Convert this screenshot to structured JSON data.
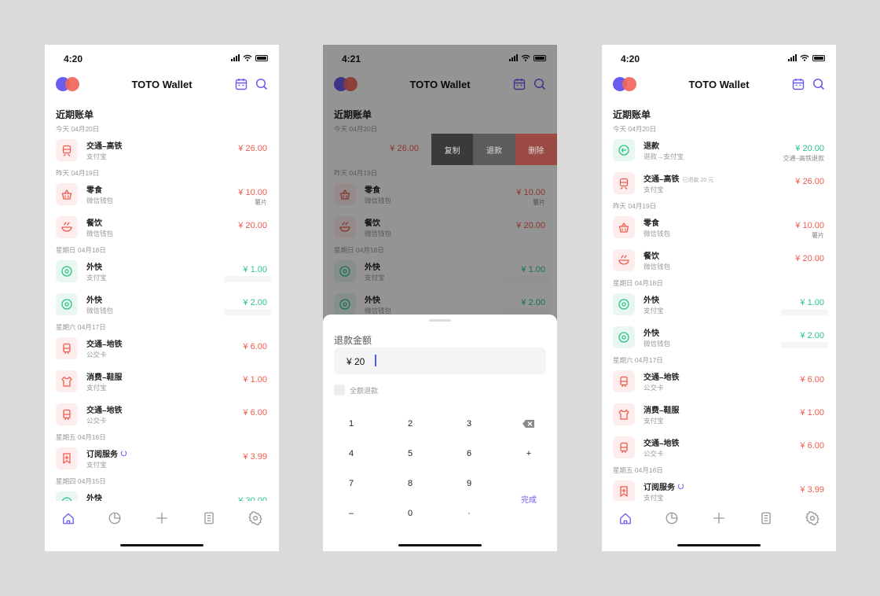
{
  "colors": {
    "accent": "#6b5cf0",
    "expense": "#ef5a4e",
    "income": "#2cc28a",
    "background": "#dadada"
  },
  "app_title": "TOTO Wallet",
  "section_title": "近期账单",
  "screen1": {
    "time": "4:20",
    "groups": [
      {
        "date": "今天 04月20日",
        "items": [
          {
            "icon": "train-icon",
            "name": "交通–高铁",
            "sub": "支付宝",
            "amount": "¥ 26.00",
            "type": "expense"
          }
        ]
      },
      {
        "date": "昨天 04月19日",
        "items": [
          {
            "icon": "basket-icon",
            "name": "零食",
            "sub": "微信钱包",
            "amount": "¥ 10.00",
            "note": "薯片",
            "type": "expense"
          },
          {
            "icon": "bowl-icon",
            "name": "餐饮",
            "sub": "微信钱包",
            "amount": "¥ 20.00",
            "type": "expense"
          }
        ]
      },
      {
        "date": "星期日 04月18日",
        "items": [
          {
            "icon": "coin-icon",
            "name": "外快",
            "sub": "支付宝",
            "amount": "¥ 1.00",
            "type": "income"
          },
          {
            "icon": "coin-icon",
            "name": "外快",
            "sub": "微信钱包",
            "amount": "¥ 2.00",
            "type": "income"
          }
        ]
      },
      {
        "date": "星期六 04月17日",
        "items": [
          {
            "icon": "subway-icon",
            "name": "交通–地铁",
            "sub": "公交卡",
            "amount": "¥ 6.00",
            "type": "expense"
          },
          {
            "icon": "shirt-icon",
            "name": "消费–鞋服",
            "sub": "支付宝",
            "amount": "¥ 1.00",
            "type": "expense"
          },
          {
            "icon": "subway-icon",
            "name": "交通–地铁",
            "sub": "公交卡",
            "amount": "¥ 6.00",
            "type": "expense"
          }
        ]
      },
      {
        "date": "星期五 04月16日",
        "items": [
          {
            "icon": "bookmark-icon",
            "name": "订阅服务",
            "sub": "支付宝",
            "amount": "¥ 3.99",
            "type": "expense",
            "repeat": true
          }
        ]
      },
      {
        "date": "星期四 04月15日",
        "items": [
          {
            "icon": "coin-icon",
            "name": "外快",
            "sub": "",
            "amount": "¥ 30.00",
            "type": "income"
          }
        ]
      }
    ]
  },
  "screen2": {
    "time": "4:21",
    "swiped_amount": "¥ 26.00",
    "swipe_actions": [
      "复制",
      "退款",
      "删除"
    ],
    "sheet": {
      "label": "退款金额",
      "value": "¥ 20",
      "checkbox_label": "全额退款",
      "keys": [
        "1",
        "2",
        "3",
        "⌫",
        "4",
        "5",
        "6",
        "+",
        "7",
        "8",
        "9",
        "完成",
        "–",
        "0",
        "·"
      ]
    }
  },
  "screen3": {
    "time": "4:20",
    "groups": [
      {
        "date": "今天 04月20日",
        "items": [
          {
            "icon": "refund-icon",
            "name": "退款",
            "sub": "退款→支付宝",
            "amount": "¥ 20.00",
            "note": "交通–高铁退款",
            "type": "income"
          },
          {
            "icon": "train-icon",
            "name": "交通–高铁",
            "tag": "已退款 20 元",
            "sub": "支付宝",
            "amount": "¥ 26.00",
            "type": "expense"
          }
        ]
      },
      {
        "date": "昨天 04月19日",
        "items": [
          {
            "icon": "basket-icon",
            "name": "零食",
            "sub": "微信钱包",
            "amount": "¥ 10.00",
            "note": "薯片",
            "type": "expense"
          },
          {
            "icon": "bowl-icon",
            "name": "餐饮",
            "sub": "微信钱包",
            "amount": "¥ 20.00",
            "type": "expense"
          }
        ]
      },
      {
        "date": "星期日 04月18日",
        "items": [
          {
            "icon": "coin-icon",
            "name": "外快",
            "sub": "支付宝",
            "amount": "¥ 1.00",
            "type": "income"
          },
          {
            "icon": "coin-icon",
            "name": "外快",
            "sub": "微信钱包",
            "amount": "¥ 2.00",
            "type": "income"
          }
        ]
      },
      {
        "date": "星期六 04月17日",
        "items": [
          {
            "icon": "subway-icon",
            "name": "交通–地铁",
            "sub": "公交卡",
            "amount": "¥ 6.00",
            "type": "expense"
          },
          {
            "icon": "shirt-icon",
            "name": "消费–鞋服",
            "sub": "支付宝",
            "amount": "¥ 1.00",
            "type": "expense"
          },
          {
            "icon": "subway-icon",
            "name": "交通–地铁",
            "sub": "公交卡",
            "amount": "¥ 6.00",
            "type": "expense"
          }
        ]
      },
      {
        "date": "星期五 04月16日",
        "items": [
          {
            "icon": "bookmark-icon",
            "name": "订阅服务",
            "sub": "支付宝",
            "amount": "¥ 3.99",
            "type": "expense",
            "repeat": true
          }
        ]
      }
    ]
  },
  "tabbar": [
    {
      "icon": "home-icon",
      "active": true
    },
    {
      "icon": "pie-chart-icon",
      "active": false
    },
    {
      "icon": "plus-icon",
      "active": false
    },
    {
      "icon": "receipt-icon",
      "active": false
    },
    {
      "icon": "settings-icon",
      "active": false
    }
  ]
}
